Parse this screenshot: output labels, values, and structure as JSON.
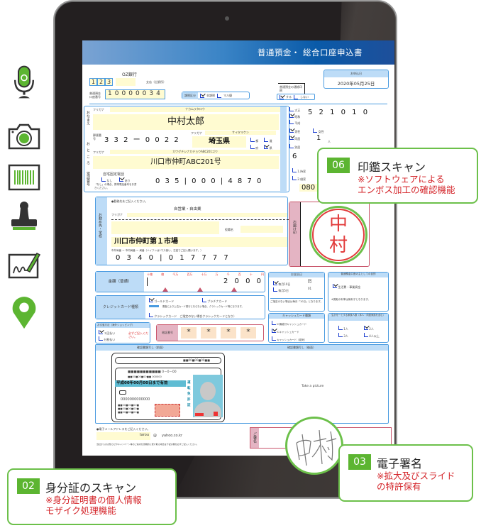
{
  "form": {
    "title": "普通預金・ 総合口座申込書",
    "bank_name": "OZ銀行",
    "branch_code": [
      "1",
      "2",
      "3"
    ],
    "branch_suffix": "支店（出張所）",
    "account_number_label": "普通預金口座番号",
    "account_number": [
      "1",
      "0",
      "0",
      "0",
      "0",
      "0",
      "3",
      "4"
    ],
    "tax_label": "課税区分",
    "tax_options": [
      {
        "label": "非課税",
        "checked": true
      },
      {
        "label": "マル優",
        "checked": false
      }
    ],
    "passbook_label": "普通預金の通帳印刷",
    "passbook_options": [
      {
        "label": "する",
        "checked": true
      },
      {
        "label": "しない",
        "checked": false
      }
    ],
    "date_label": "お申込日",
    "date": "2020年05月25日",
    "name_label": "おなまえ",
    "furigana_label": "フリガナ",
    "name_furigana": "ナカムラタロウ",
    "name": "中村太郎",
    "name_suffix": "様",
    "address_label": "おところ",
    "postal_label": "郵便番号",
    "postal_code": "3 3 2 ー 0 0 2 2",
    "prefecture_furigana": "サイタマケン",
    "prefecture": "埼玉県",
    "prefecture_types": [
      {
        "label": "都",
        "checked": false
      },
      {
        "label": "道",
        "checked": false
      },
      {
        "label": "府",
        "checked": false
      },
      {
        "label": "県",
        "checked": true
      }
    ],
    "address_furigana": "カワグチシナカチョウABC201ゴウ",
    "address": "川口市仲町ABC201号",
    "phone_label": "電話番号",
    "home_phone_label": "自宅固定電話",
    "home_phone_options": [
      {
        "label": "なし",
        "checked": false
      },
      {
        "label": "あり",
        "checked": true
      }
    ],
    "home_phone_note": "「なし」の場合、携帯電話番号をお書きください。",
    "phone_number": "0 3 5 | 0 0 0 | 4 8 7 0",
    "birth_label": "生年月日",
    "birth_era": [
      {
        "label": "大正",
        "checked": false
      },
      {
        "label": "昭和",
        "checked": true
      },
      {
        "label": "平成",
        "checked": false
      }
    ],
    "birth_date": "5 2   1 0   1 0",
    "gender_options": [
      {
        "label": "男性",
        "checked": true
      },
      {
        "label": "女性",
        "checked": false
      }
    ],
    "household_label": "二世帯",
    "household_options": [
      {
        "label": "同居",
        "checked": true
      },
      {
        "label": "別居",
        "checked": false
      }
    ],
    "children_count": "1",
    "children_unit": "人",
    "right_options": [
      {
        "label": "同居",
        "checked": true
      },
      {
        "label": "別居",
        "checked": false
      }
    ],
    "occupation_code": "6",
    "residence_options": [
      {
        "label": "1.持家",
        "checked": false
      },
      {
        "label": "2.借家",
        "checked": false
      }
    ],
    "mobile_label": "携帯番号",
    "mobile_prefix": "080",
    "work_note": "●勤務先をご記入ください。",
    "work_section_label": "お勤め先・学校",
    "work_type": "自営業・自由業",
    "work_name_label": "お勤め先",
    "dept_label": "役職名",
    "work_address": "川口市仲町第１市場",
    "work_phone_note": "市外局番 ー 市内局番 ー 局番（ハイフンは1マス使い、左詰でご記入願います。）",
    "work_phone": "0 3 4 0 | 0 1 7 7 7 7",
    "seal_label": "お届け印",
    "seal_chars": [
      "中",
      "村"
    ],
    "amount_label": "金額（普通）",
    "amount_units": [
      "十億",
      "億",
      "千万",
      "百万",
      "十万",
      "万",
      "千",
      "百",
      "十",
      "円"
    ],
    "amount": "2 0 0 0 | 0",
    "card_type_label": "クレジットカード種類",
    "card_options": [
      {
        "label": "ゴールドカード",
        "checked": true
      },
      {
        "label": "プラチナカード",
        "checked": false
      },
      {
        "label": "クラシックカード　ご指定のない場合クラシックカードとなり）",
        "checked": false
      }
    ],
    "card_note": "審査により上位カード発行とならない場合、クラシックカード等になります。",
    "shopping_label": "お引落方法（海外ショッピング）",
    "shopping_options": [
      {
        "label": "１回払い",
        "checked": true
      },
      {
        "label": "分割払い",
        "checked": false
      }
    ],
    "shopping_note": "必ずご記入ください。",
    "pin_label": "暗証番号",
    "pin": [
      "*",
      "*",
      "*",
      "*"
    ],
    "statement_label": "お支払日",
    "statement_options": [
      {
        "label": "毎月10日",
        "value": "03",
        "checked": true
      },
      {
        "label": "毎月5日",
        "value": "01",
        "checked": false
      }
    ],
    "statement_note": "ご指定のない場合は毎月「10日」となります。",
    "purpose_label": "普通預金口座の主としての目的",
    "purpose_options": [
      {
        "label": "生活費・事業資金",
        "checked": true
      }
    ],
    "purpose_note": "※受取の利率は無利子となります。",
    "cash_card_label": "キャッシュカード種類",
    "cash_card_options": [
      {
        "label": "IC機能付キャッシュカード",
        "checked": false
      },
      {
        "label": "ICキャッシュカード",
        "checked": true
      },
      {
        "label": "キャッシュカード（磁気）",
        "checked": false
      }
    ],
    "household_count_label": "生計を一とする家族人数（本人・同居家族を含む）",
    "household_count_options": [
      {
        "label": "1人",
        "checked": false
      },
      {
        "label": "2人",
        "checked": true
      },
      {
        "label": "3人",
        "checked": false
      },
      {
        "label": "4人以上",
        "checked": false
      }
    ],
    "id_front_label": "確認書類写し（前面）",
    "id_back_label": "確認書類写し（後面）",
    "id_back_placeholder": "Take a picture",
    "id_card": {
      "validity": "平成00年00月00日まで有効",
      "type_chars": [
        "運",
        "転",
        "免",
        "許",
        "証"
      ],
      "number": "0000000000000",
      "code": "0－0－00"
    },
    "email_note": "●電子メールアドレスをご記入ください。",
    "email_user": "tarou",
    "email_at": "@",
    "email_domain": "yahoo.co.kr",
    "campaign_note": "当社からのお知らせやキャンペーン等のご案内を定期的に受け取る場合は下記の欄を必ずご記入ください。",
    "signature_label": "ご署名",
    "signature_text": "中村"
  },
  "callouts": [
    {
      "number": "06",
      "title": "印鑑スキャン",
      "sub": [
        "※ソフトウェアによる",
        "エンボス加工の確認機能"
      ]
    },
    {
      "number": "02",
      "title": "身分証のスキャン",
      "sub": [
        "※身分証明書の個人情報",
        "モザイク処理機能"
      ]
    },
    {
      "number": "03",
      "title": "電子署名",
      "sub": [
        "※拡大及びスライド",
        "の特許保有"
      ]
    }
  ],
  "side_icons": [
    "microphone-icon",
    "camera-icon",
    "barcode-icon",
    "stamp-icon",
    "signature-pad-icon",
    "location-pin-icon"
  ],
  "colors": {
    "accent_green": "#5cb531",
    "callout_red": "#d4252a",
    "form_blue": "#4a9be0",
    "header_blue": "#0a5aa8"
  }
}
